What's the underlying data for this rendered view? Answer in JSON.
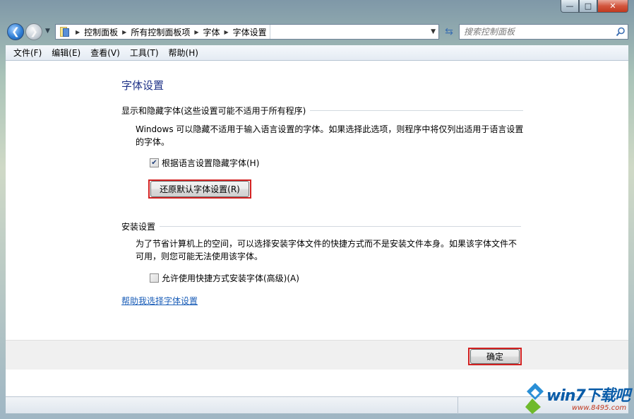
{
  "nav": {
    "breadcrumbs": [
      "控制面板",
      "所有控制面板项",
      "字体",
      "字体设置"
    ],
    "search_placeholder": "搜索控制面板"
  },
  "menu": [
    "文件(F)",
    "编辑(E)",
    "查看(V)",
    "工具(T)",
    "帮助(H)"
  ],
  "page": {
    "title": "字体设置",
    "section1": {
      "heading": "显示和隐藏字体(这些设置可能不适用于所有程序)",
      "description": "Windows 可以隐藏不适用于输入语言设置的字体。如果选择此选项，则程序中将仅列出适用于语言设置的字体。",
      "checkbox_label": "根据语言设置隐藏字体(H)",
      "checkbox_checked": true,
      "restore_button": "还原默认字体设置(R)"
    },
    "section2": {
      "heading": "安装设置",
      "description": "为了节省计算机上的空间，可以选择安装字体文件的快捷方式而不是安装文件本身。如果该字体文件不可用，则您可能无法使用该字体。",
      "checkbox_label": "允许使用快捷方式安装字体(高级)(A)",
      "checkbox_checked": false
    },
    "help_link": "帮助我选择字体设置"
  },
  "footer": {
    "ok_button": "确定"
  },
  "watermark": {
    "title": "win7下载吧",
    "url": "www.8495.com"
  },
  "colors": {
    "title_blue": "#1e3287",
    "link_blue": "#1b5eb8",
    "highlight_red": "#d22121"
  }
}
